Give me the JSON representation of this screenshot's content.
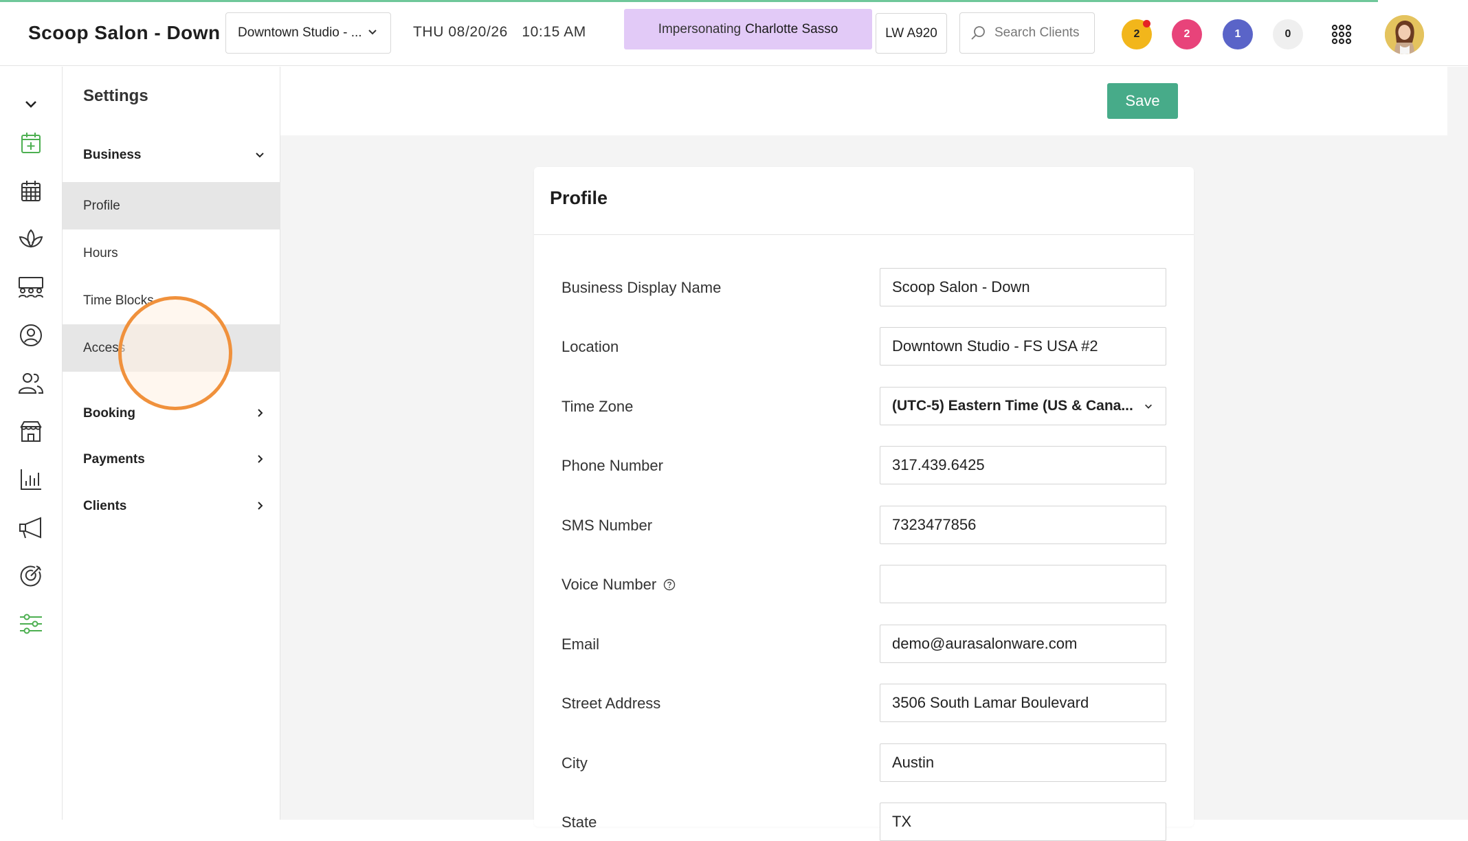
{
  "header": {
    "app_title": "Scoop Salon - Down",
    "location_select": "Downtown Studio - ...",
    "date": "THU 08/20/26",
    "time": "10:15 AM",
    "impersonating_prefix": "Impersonating",
    "impersonating_name": "Charlotte Sasso",
    "lw_badge": "LW A920",
    "search_placeholder": "Search Clients",
    "counters": [
      {
        "value": "2",
        "color": "#f2b61b",
        "has_dot": true
      },
      {
        "value": "2",
        "color": "#e8437a",
        "has_dot": false
      },
      {
        "value": "1",
        "color": "#5a64c8",
        "has_dot": false
      },
      {
        "value": "0",
        "color": "#efefef",
        "has_dot": false
      }
    ]
  },
  "rail": {
    "icons": [
      "chevron-down-icon",
      "calendar-add-icon",
      "calendar-grid-icon",
      "lotus-icon",
      "staff-group-icon",
      "user-circle-icon",
      "users-icon",
      "store-icon",
      "bar-chart-icon",
      "megaphone-icon",
      "target-icon",
      "sliders-icon"
    ],
    "active_color": "#4caf50"
  },
  "settings_nav": {
    "title": "Settings",
    "groups": [
      {
        "label": "Business",
        "expanded": true,
        "items": [
          "Profile",
          "Hours",
          "Time Blocks",
          "Access"
        ]
      },
      {
        "label": "Booking",
        "expanded": false
      },
      {
        "label": "Payments",
        "expanded": false
      },
      {
        "label": "Clients",
        "expanded": false
      }
    ],
    "active_item": "Profile"
  },
  "toolbar": {
    "save_label": "Save",
    "save_color": "#47ab89"
  },
  "profile": {
    "title": "Profile",
    "fields": [
      {
        "label": "Business Display Name",
        "value": "Scoop Salon - Down"
      },
      {
        "label": "Location",
        "value": "Downtown Studio - FS USA #2"
      },
      {
        "label": "Time Zone",
        "value": "(UTC-5) Eastern Time (US & Cana..."
      },
      {
        "label": "Phone Number",
        "value": "317.439.6425"
      },
      {
        "label": "SMS Number",
        "value": "7323477856"
      },
      {
        "label": "Voice Number",
        "value": ""
      },
      {
        "label": "Email",
        "value": "demo@aurasalonware.com"
      },
      {
        "label": "Street Address",
        "value": "3506 South Lamar Boulevard"
      },
      {
        "label": "City",
        "value": "Austin"
      },
      {
        "label": "State",
        "value": "TX"
      }
    ]
  }
}
